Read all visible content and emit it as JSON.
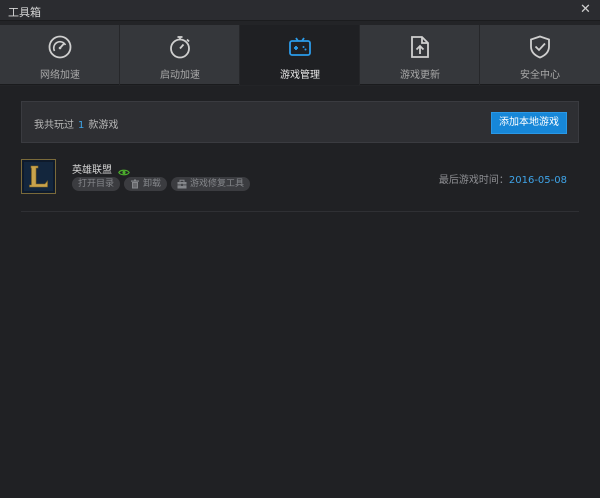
{
  "window": {
    "title": "工具箱",
    "close_glyph": "✕"
  },
  "tabs": [
    {
      "label": "网络加速",
      "icon": "speedometer-icon",
      "active": false
    },
    {
      "label": "启动加速",
      "icon": "stopwatch-icon",
      "active": false
    },
    {
      "label": "游戏管理",
      "icon": "gamepad-icon",
      "active": true
    },
    {
      "label": "游戏更新",
      "icon": "update-icon",
      "active": false
    },
    {
      "label": "安全中心",
      "icon": "shield-icon",
      "active": false
    }
  ],
  "summary": {
    "prefix": "我共玩过",
    "count": "1",
    "suffix": "款游戏",
    "add_button": "添加本地游戏"
  },
  "games": [
    {
      "name": "英雄联盟",
      "icon": "league-of-legends-logo",
      "actions": [
        {
          "label": "打开目录",
          "icon": ""
        },
        {
          "label": "卸载",
          "icon": "trash-icon"
        },
        {
          "label": "游戏修复工具",
          "icon": "toolbox-icon"
        }
      ],
      "last_played_label": "最后游戏时间：",
      "last_played_date": "2016-05-08"
    }
  ],
  "colors": {
    "accent": "#1787d8",
    "link": "#3fa4e8",
    "active_icon": "#2b9be9",
    "background": "#202124",
    "tab_bar": "#35373b",
    "eye_green": "#4caf2c"
  }
}
